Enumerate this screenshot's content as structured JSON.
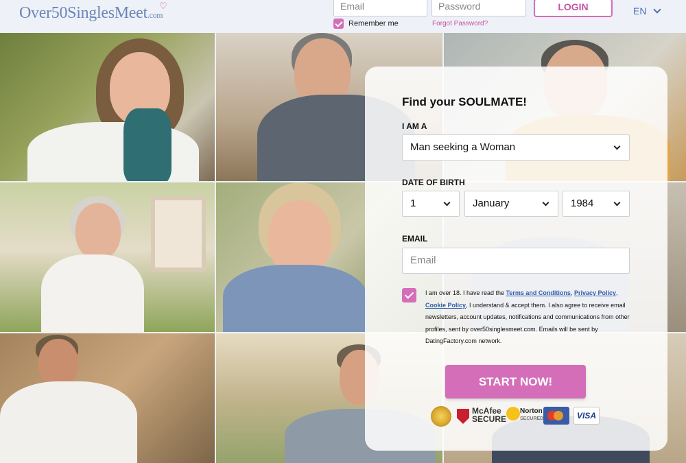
{
  "header": {
    "logo_main": "Over50SinglesMeet",
    "logo_domain": ".com",
    "email_placeholder": "Email",
    "password_placeholder": "Password",
    "login_label": "LOGIN",
    "remember_label": "Remember me",
    "forgot_label": "Forgot Password?",
    "language": "EN"
  },
  "signup": {
    "title": "Find your SOULMATE!",
    "i_am_label": "I AM A",
    "i_am_value": "Man seeking a Woman",
    "dob_label": "DATE OF BIRTH",
    "dob_day": "1",
    "dob_month": "January",
    "dob_year": "1984",
    "email_label": "EMAIL",
    "email_placeholder": "Email",
    "terms_pre": "I am over 18. I have read the ",
    "terms_link1": "Terms and Conditions",
    "terms_sep1": ", ",
    "terms_link2": "Privacy Policy",
    "terms_sep2": ",",
    "terms_link3": "Cookie Policy",
    "terms_post": ", I understand & accept them. I also agree to receive email newsletters, account updates, notifications and communications from other profiles, sent by over50singlesmeet.com. Emails will be sent by DatingFactory.com network.",
    "start_label": "START NOW!"
  },
  "badges": {
    "mcafee_line1": "McAfee",
    "mcafee_line2": "SECURE",
    "norton_line1": "Norton",
    "norton_line2": "SECURED",
    "visa": "VISA"
  },
  "colors": {
    "accent_pink": "#d46eb8",
    "link_blue": "#2f5ea8",
    "logo_blue": "#6b86b8"
  }
}
